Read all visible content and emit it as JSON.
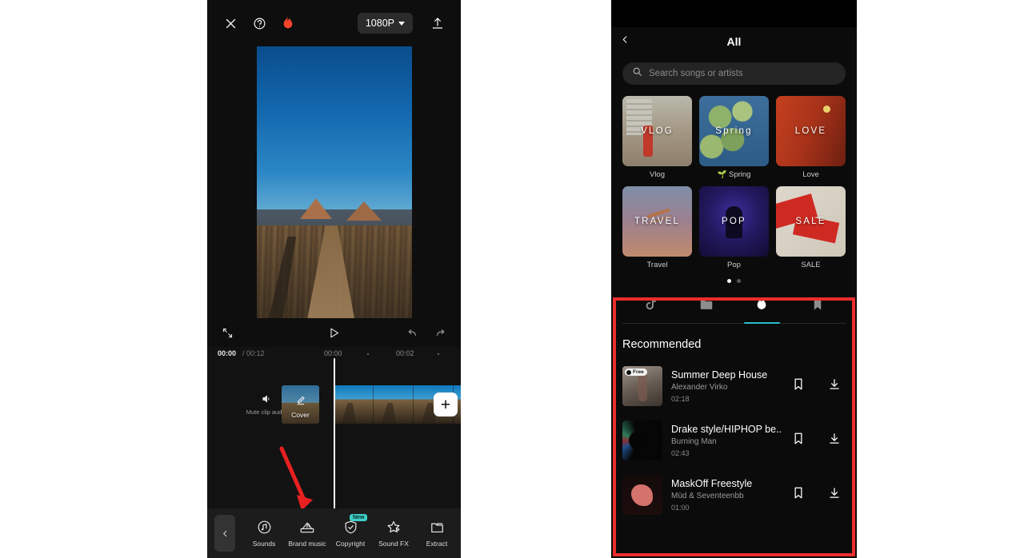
{
  "editor": {
    "topbar": {
      "close_icon": "close-icon",
      "help_icon": "help-icon",
      "flame_icon": "flame-icon",
      "resolution": "1080P",
      "export_icon": "upload-icon"
    },
    "transport": {
      "fullscreen_icon": "fullscreen-icon",
      "play_icon": "play-icon",
      "undo_icon": "undo-icon",
      "redo_icon": "redo-icon"
    },
    "timeline": {
      "current_time": "00:00",
      "total_time": "/ 00:12",
      "mark_0": "00:00",
      "mark_1": "00:02",
      "mute_label": "Mute clip audio",
      "cover_label": "Cover",
      "add_label": "+"
    },
    "toolbar": {
      "collapse_icon": "chevron-left-icon",
      "tools": [
        {
          "label": "Sounds",
          "icon": "music-note-icon",
          "badge": ""
        },
        {
          "label": "Brand music",
          "icon": "brand-music-icon",
          "badge": ""
        },
        {
          "label": "Copyright",
          "icon": "shield-check-icon",
          "badge": "New"
        },
        {
          "label": "Sound FX",
          "icon": "star-fx-icon",
          "badge": ""
        },
        {
          "label": "Extract",
          "icon": "extract-folder-icon",
          "badge": ""
        }
      ]
    }
  },
  "music": {
    "back_icon": "chevron-left-icon",
    "title": "All",
    "search": {
      "icon": "search-icon",
      "placeholder": "Search songs or artists",
      "value": ""
    },
    "categories": [
      {
        "overlay": "VLOG",
        "label": "Vlog",
        "art": "art-vlog"
      },
      {
        "overlay": "Spring",
        "label": "🌱 Spring",
        "art": "art-spring"
      },
      {
        "overlay": "LOVE",
        "label": "Love",
        "art": "art-love"
      },
      {
        "overlay": "TRAVEL",
        "label": "Travel",
        "art": "art-travel"
      },
      {
        "overlay": "POP",
        "label": "Pop",
        "art": "art-pop"
      },
      {
        "overlay": "SALE",
        "label": "SALE",
        "art": "art-sale"
      }
    ],
    "pager": {
      "total": 2,
      "active": 0
    },
    "tabs": [
      {
        "icon": "tiktok-note-icon",
        "active": false
      },
      {
        "icon": "folder-icon",
        "active": false
      },
      {
        "icon": "flame-icon",
        "active": true
      },
      {
        "icon": "bookmark-icon",
        "active": false
      }
    ],
    "section_title": "Recommended",
    "songs": [
      {
        "title": "Summer Deep House",
        "artist": "Alexander Virko",
        "duration": "02:18",
        "badge": "Free",
        "thumb": "th-a",
        "bookmark_icon": "bookmark-icon",
        "download_icon": "download-icon"
      },
      {
        "title": "Drake style/HIPHOP be..",
        "artist": "Burning Man",
        "duration": "02:43",
        "badge": "",
        "thumb": "th-b",
        "bookmark_icon": "bookmark-icon",
        "download_icon": "download-icon"
      },
      {
        "title": "MaskOff Freestyle",
        "artist": "Müd & Seventeenbb",
        "duration": "01:00",
        "badge": "",
        "thumb": "th-c",
        "bookmark_icon": "bookmark-icon",
        "download_icon": "download-icon"
      }
    ]
  },
  "annotations": {
    "highlight_color": "#ed2d2d",
    "arrow_color": "#e92020",
    "accent_color": "#29bcc8",
    "badge_color": "#3dcfc8"
  }
}
